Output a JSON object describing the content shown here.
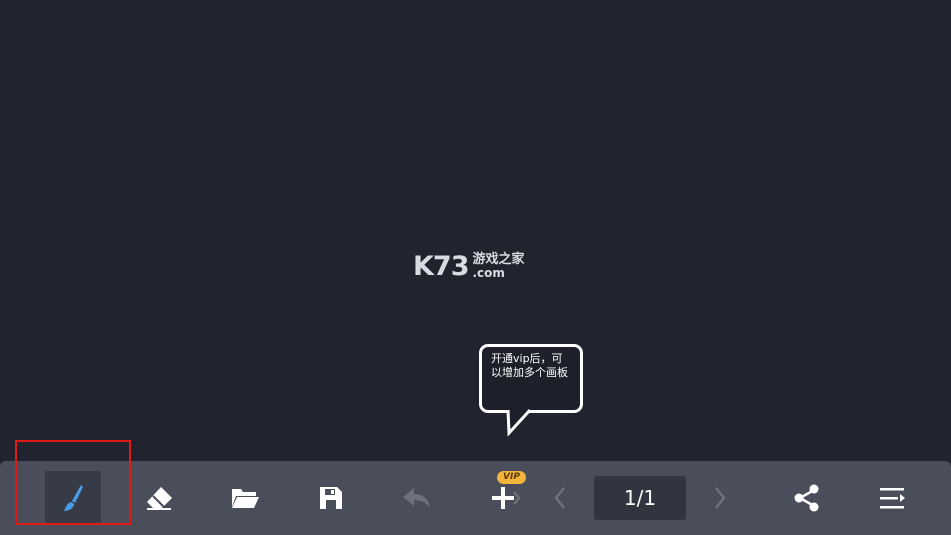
{
  "watermark": {
    "brand": "K73",
    "cn": "游戏之家",
    "com": ".com"
  },
  "tooltip": {
    "text": "开通vip后，可以增加多个画板"
  },
  "toolbar": {
    "tools": [
      {
        "name": "brush",
        "icon": "brush-icon",
        "active": true
      },
      {
        "name": "eraser",
        "icon": "eraser-icon"
      },
      {
        "name": "open",
        "icon": "folder-open-icon"
      },
      {
        "name": "save",
        "icon": "save-icon"
      },
      {
        "name": "undo",
        "icon": "undo-icon",
        "disabled": true
      },
      {
        "name": "add-board",
        "icon": "plus-icon"
      },
      {
        "name": "prev-page",
        "icon": "chevron-left-icon",
        "disabled": true
      },
      {
        "name": "next-page",
        "icon": "chevron-right-icon",
        "disabled": true
      },
      {
        "name": "share",
        "icon": "share-icon"
      },
      {
        "name": "menu",
        "icon": "menu-icon"
      }
    ],
    "vip_badge": "VIP",
    "page_indicator": "1/1"
  },
  "colors": {
    "canvas_bg": "#21232f",
    "toolbar_bg": "#4a4e5a",
    "brush_accent": "#4a9ee8",
    "vip_badge": "#f2b53c",
    "highlight": "#e01919"
  }
}
